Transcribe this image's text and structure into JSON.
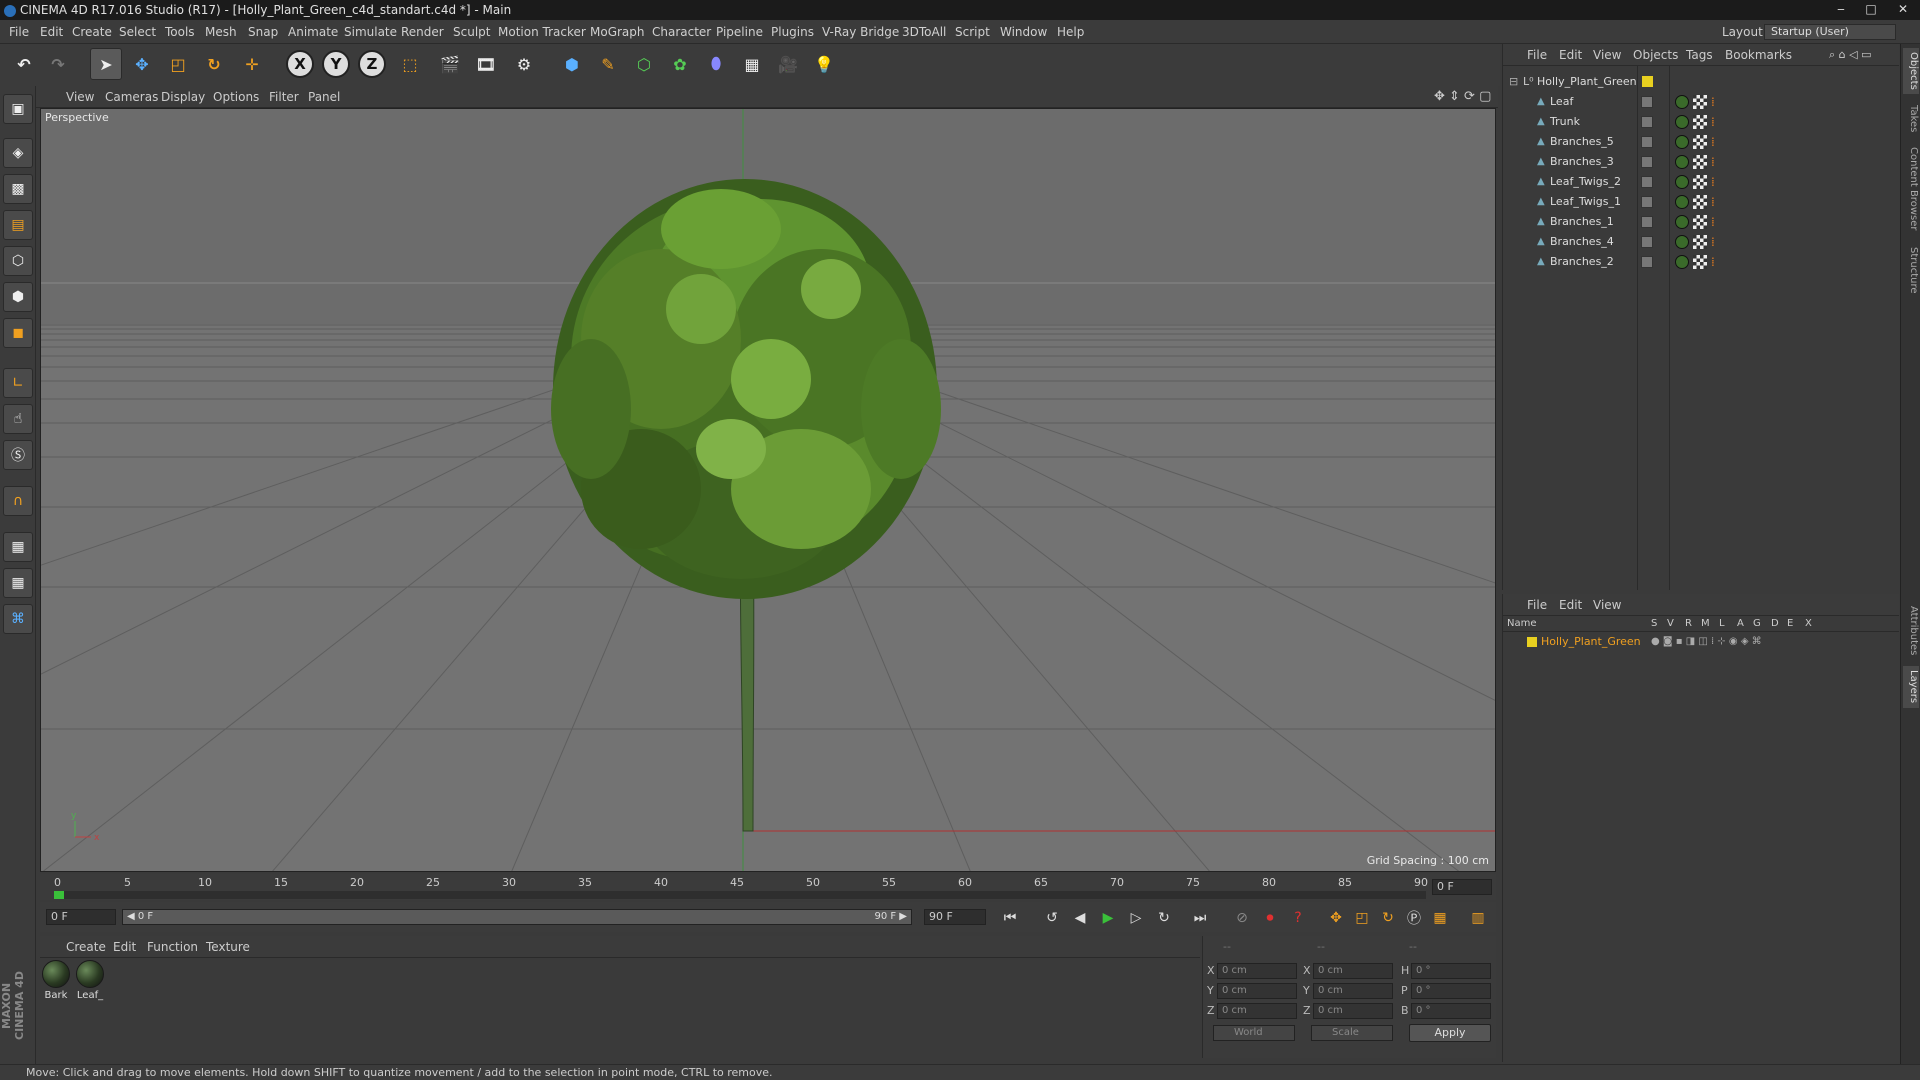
{
  "window": {
    "title": "CINEMA 4D R17.016 Studio (R17) - [Holly_Plant_Green_c4d_standart.c4d *] - Main",
    "minimize": "‒",
    "maximize": "□",
    "close": "✕"
  },
  "menubar": [
    "File",
    "Edit",
    "Create",
    "Select",
    "Tools",
    "Mesh",
    "Snap",
    "Animate",
    "Simulate",
    "Render",
    "Sculpt",
    "Motion Tracker",
    "MoGraph",
    "Character",
    "Pipeline",
    "Plugins",
    "V-Ray Bridge",
    "3DToAll",
    "Script",
    "Window",
    "Help"
  ],
  "layout": {
    "label": "Layout:",
    "value": "Startup (User)"
  },
  "viewport": {
    "menu": [
      "View",
      "Cameras",
      "Display",
      "Options",
      "Filter",
      "Panel"
    ],
    "label": "Perspective",
    "grid_spacing": "Grid Spacing : 100 cm",
    "axis_y": "y",
    "axis_x": "x"
  },
  "timeline": {
    "ticks": [
      "0",
      "5",
      "10",
      "15",
      "20",
      "25",
      "30",
      "35",
      "40",
      "45",
      "50",
      "55",
      "60",
      "65",
      "70",
      "75",
      "80",
      "85",
      "90"
    ],
    "current_frame_field": "0 F"
  },
  "transport": {
    "start_field": "0 F",
    "range_start": "◀ 0 F",
    "range_end": "90 F ▶",
    "end_field": "90 F"
  },
  "material_manager": {
    "menu": [
      "Create",
      "Edit",
      "Function",
      "Texture"
    ],
    "materials": [
      {
        "label": "Bark"
      },
      {
        "label": "Leaf_"
      }
    ]
  },
  "coordinates": {
    "headers": [
      "--",
      "--",
      "--"
    ],
    "rows": [
      {
        "a": "X",
        "av": "0 cm",
        "b": "X",
        "bv": "0 cm",
        "c": "H",
        "cv": "0 °"
      },
      {
        "a": "Y",
        "av": "0 cm",
        "b": "Y",
        "bv": "0 cm",
        "c": "P",
        "cv": "0 °"
      },
      {
        "a": "Z",
        "av": "0 cm",
        "b": "Z",
        "bv": "0 cm",
        "c": "B",
        "cv": "0 °"
      }
    ],
    "world": "World",
    "scale": "Scale",
    "apply": "Apply"
  },
  "object_manager": {
    "menu": [
      "File",
      "Edit",
      "View",
      "Objects",
      "Tags",
      "Bookmarks"
    ],
    "root": "Holly_Plant_Green",
    "children": [
      "Leaf",
      "Trunk",
      "Branches_5",
      "Branches_3",
      "Leaf_Twigs_2",
      "Leaf_Twigs_1",
      "Branches_1",
      "Branches_4",
      "Branches_2"
    ]
  },
  "layer_manager": {
    "menu": [
      "File",
      "Edit",
      "View"
    ],
    "columns": [
      "Name",
      "S",
      "V",
      "R",
      "M",
      "L",
      "A",
      "G",
      "D",
      "E",
      "X"
    ],
    "layer_name": "Holly_Plant_Green"
  },
  "right_tabs": [
    "Objects",
    "Takes",
    "Content Browser",
    "Structure",
    "Attributes",
    "Layers"
  ],
  "status": "Move: Click and drag to move elements. Hold down SHIFT to quantize movement / add to the selection in point mode, CTRL to remove.",
  "brand": "MAXON CINEMA 4D"
}
